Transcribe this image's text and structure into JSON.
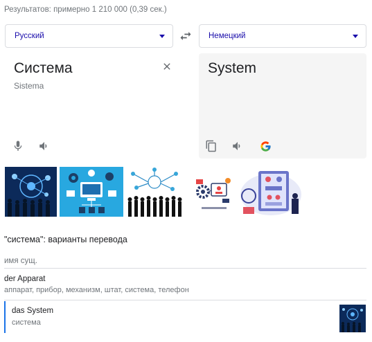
{
  "results_stats": "Результатов: примерно 1 210 000 (0,39 сек.)",
  "source_language": "Русский",
  "target_language": "Немецкий",
  "source_text": "Система",
  "source_transliteration": "Sistema",
  "translation": "System",
  "icons": {
    "swap": "swap-arrows-icon",
    "clear": "close-icon",
    "mic": "microphone-icon",
    "listen_source": "speaker-icon",
    "copy": "copy-icon",
    "listen_target": "speaker-icon",
    "google": "google-logo-icon"
  },
  "images": [
    {
      "name": "business-network-people"
    },
    {
      "name": "computer-system-diagram"
    },
    {
      "name": "people-silhouettes-network"
    },
    {
      "name": "system-setting-gears"
    },
    {
      "name": "flowchart-illustration"
    }
  ],
  "variants": {
    "title": "\"система\": варианты перевода",
    "part_of_speech": "имя сущ.",
    "entries": [
      {
        "word": "der Apparat",
        "synonyms": "аппарат, прибор, механизм, штат, система, телефон"
      },
      {
        "word": "das System",
        "synonyms": "система"
      }
    ]
  },
  "colors": {
    "link_blue": "#1a0dab",
    "accent_blue": "#1a73e8",
    "muted_text": "#70757a",
    "target_pane_bg": "#f5f5f5"
  }
}
